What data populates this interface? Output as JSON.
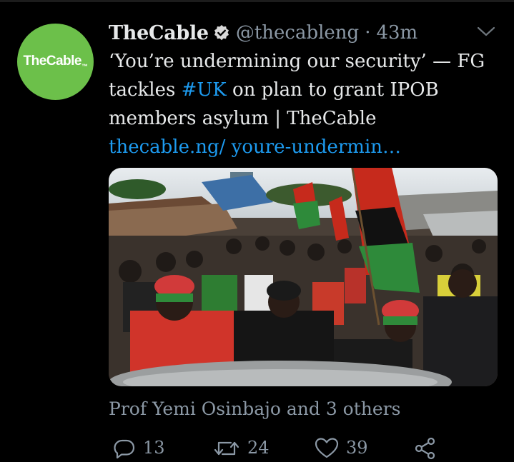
{
  "tweet": {
    "avatar_text": "TheCable",
    "avatar_mark": "™",
    "author_name": "TheCable",
    "handle": "@thecableng",
    "separator": "·",
    "time": "43m",
    "text_before": "‘You’re undermining our security’ — FG tackles ",
    "hashtag": "#UK",
    "text_after": " on plan to grant IPOB members asylum | TheCable",
    "link": "thecable.ng/ youre-undermin…",
    "likers": "Prof Yemi Osinbajo and 3 others",
    "replies": "13",
    "retweets": "24",
    "likes": "39"
  },
  "colors": {
    "background": "#000000",
    "accent": "#1d9bf0",
    "avatar_bg": "#6cc04a",
    "muted": "#8b98a5"
  },
  "icons": [
    "verified-badge-icon",
    "chevron-down-icon",
    "reply-icon",
    "retweet-icon",
    "like-icon",
    "share-icon"
  ]
}
